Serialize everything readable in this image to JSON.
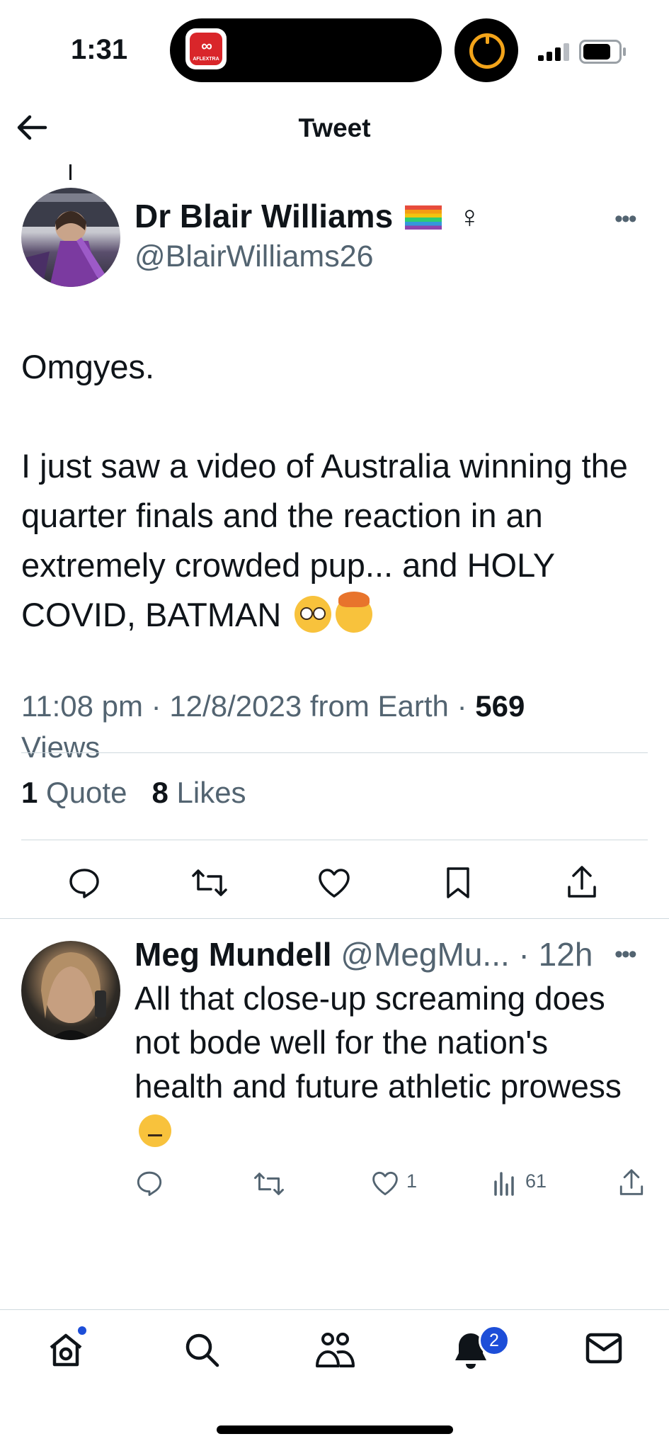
{
  "status_bar": {
    "time": "1:31",
    "island_app_label": "AFLEXTRA",
    "island_app_glyph": "ABC"
  },
  "header": {
    "title": "Tweet"
  },
  "tweet": {
    "author_name": "Dr Blair Williams",
    "author_handle": "@BlairWilliams26",
    "text": "Omgyes.\n\nI just saw a video of Australia winning the quarter finals and the reaction in an extremely crowded pup... and HOLY COVID, BATMAN",
    "meta_time": "11:08 pm",
    "meta_date": "12/8/2023",
    "meta_source": "from Earth",
    "views_count": "569",
    "views_label": "Views",
    "quotes_count": "1",
    "quotes_label": "Quote",
    "likes_count": "8",
    "likes_label": "Likes"
  },
  "reply": {
    "author_name": "Meg Mundell",
    "author_handle": "@MegMu...",
    "time": "12h",
    "text": "All that close-up screaming does not bode well for the nation's health and future athletic prowess",
    "likes": "1",
    "views": "61"
  },
  "bottom_nav": {
    "notifications_badge": "2"
  },
  "colors": {
    "text_primary": "#0f1419",
    "text_secondary": "#536471",
    "divider": "#cfd9de",
    "badge": "#1d4ed8"
  }
}
